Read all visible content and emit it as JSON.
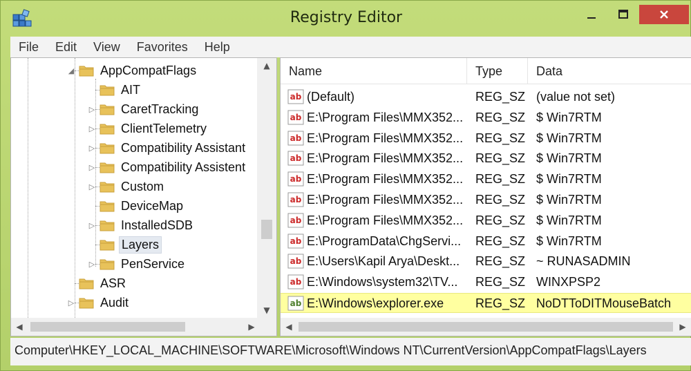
{
  "window": {
    "title": "Registry Editor"
  },
  "menu": [
    "File",
    "Edit",
    "View",
    "Favorites",
    "Help"
  ],
  "tree": {
    "items": [
      {
        "label": "AppCompatFlags",
        "expander": "◢"
      },
      {
        "label": "AIT",
        "expander": ""
      },
      {
        "label": "CaretTracking",
        "expander": "▷"
      },
      {
        "label": "ClientTelemetry",
        "expander": "▷"
      },
      {
        "label": "Compatibility Assistant",
        "expander": "▷"
      },
      {
        "label": "Compatibility Assistent",
        "expander": "▷"
      },
      {
        "label": "Custom",
        "expander": "▷"
      },
      {
        "label": "DeviceMap",
        "expander": ""
      },
      {
        "label": "InstalledSDB",
        "expander": "▷"
      },
      {
        "label": "Layers",
        "expander": ""
      },
      {
        "label": "PenService",
        "expander": "▷"
      },
      {
        "label": "ASR",
        "expander": ""
      },
      {
        "label": "Audit",
        "expander": "▷"
      }
    ],
    "selected_index": 9
  },
  "list": {
    "columns": {
      "name": "Name",
      "type": "Type",
      "data": "Data"
    },
    "rows": [
      {
        "name": "(Default)",
        "type": "REG_SZ",
        "data": "(value not set)"
      },
      {
        "name": "E:\\Program Files\\MMX352...",
        "type": "REG_SZ",
        "data": "$ Win7RTM"
      },
      {
        "name": "E:\\Program Files\\MMX352...",
        "type": "REG_SZ",
        "data": "$ Win7RTM"
      },
      {
        "name": "E:\\Program Files\\MMX352...",
        "type": "REG_SZ",
        "data": "$ Win7RTM"
      },
      {
        "name": "E:\\Program Files\\MMX352...",
        "type": "REG_SZ",
        "data": "$ Win7RTM"
      },
      {
        "name": "E:\\Program Files\\MMX352...",
        "type": "REG_SZ",
        "data": "$ Win7RTM"
      },
      {
        "name": "E:\\Program Files\\MMX352...",
        "type": "REG_SZ",
        "data": "$ Win7RTM"
      },
      {
        "name": "E:\\ProgramData\\ChgServi...",
        "type": "REG_SZ",
        "data": "$ Win7RTM"
      },
      {
        "name": "E:\\Users\\Kapil Arya\\Deskt...",
        "type": "REG_SZ",
        "data": "~ RUNASADMIN"
      },
      {
        "name": "E:\\Windows\\system32\\TV...",
        "type": "REG_SZ",
        "data": "WINXPSP2"
      },
      {
        "name": "E:\\Windows\\explorer.exe",
        "type": "REG_SZ",
        "data": "NoDTToDITMouseBatch"
      }
    ],
    "selected_index": 10
  },
  "status": {
    "path": "Computer\\HKEY_LOCAL_MACHINE\\SOFTWARE\\Microsoft\\Windows NT\\CurrentVersion\\AppCompatFlags\\Layers"
  },
  "icons": {
    "reg_sz_icon": "ab",
    "colors": {
      "folder": "#e8c25a",
      "folder_dark": "#c9a03c",
      "ab_red": "#cc2a2a",
      "ab_green": "#4f7f2e",
      "selection": "#ffffa0"
    }
  }
}
